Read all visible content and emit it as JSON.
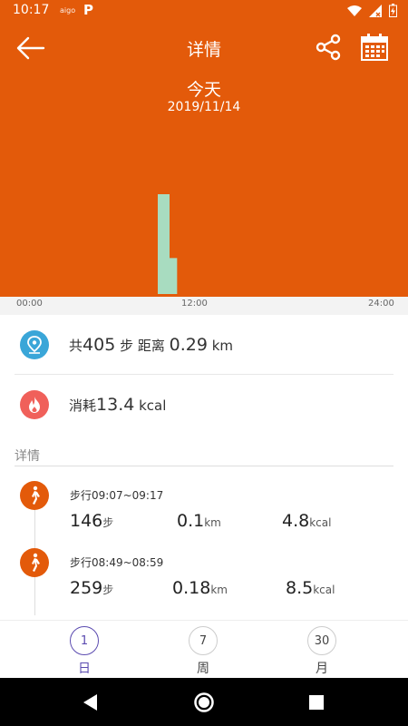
{
  "status_bar": {
    "time": "10:17",
    "note": "aigo",
    "p_icon": "P",
    "icons": [
      "wifi-icon",
      "signal-icon",
      "battery-icon"
    ]
  },
  "header": {
    "title": "详情",
    "day": "今天",
    "date": "2019/11/14",
    "icons": [
      "back-arrow-icon",
      "share-icon",
      "calendar-icon"
    ]
  },
  "chart_data": {
    "type": "bar",
    "x": [
      "09:00",
      "09:30"
    ],
    "values": [
      405,
      146
    ],
    "x_ticks": [
      "00:00",
      "12:00",
      "24:00"
    ],
    "xlim": [
      "00:00",
      "24:00"
    ],
    "bar_color": "#a8dcc0",
    "grid": false
  },
  "summary": {
    "steps_prefix": "共",
    "steps_value": "405",
    "steps_unit": "步",
    "distance_label": "距离",
    "distance_value": "0.29",
    "distance_unit": "km",
    "calories_label": "消耗",
    "calories_value": "13.4",
    "calories_unit": "kcal"
  },
  "details": {
    "header": "详情",
    "entries": [
      {
        "title": "步行09:07~09:17",
        "steps": "146",
        "steps_unit": "步",
        "distance": "0.1",
        "distance_unit": "km",
        "calories": "4.8",
        "calories_unit": "kcal"
      },
      {
        "title": "步行08:49~08:59",
        "steps": "259",
        "steps_unit": "步",
        "distance": "0.18",
        "distance_unit": "km",
        "calories": "8.5",
        "calories_unit": "kcal"
      }
    ]
  },
  "tabs": [
    {
      "number": "1",
      "label": "日",
      "active": true
    },
    {
      "number": "7",
      "label": "周",
      "active": false
    },
    {
      "number": "30",
      "label": "月",
      "active": false
    }
  ],
  "colors": {
    "accent": "#e35a0a",
    "location": "#3aa6d8",
    "fire": "#f0605a",
    "tab_active": "#5b4bb0"
  }
}
